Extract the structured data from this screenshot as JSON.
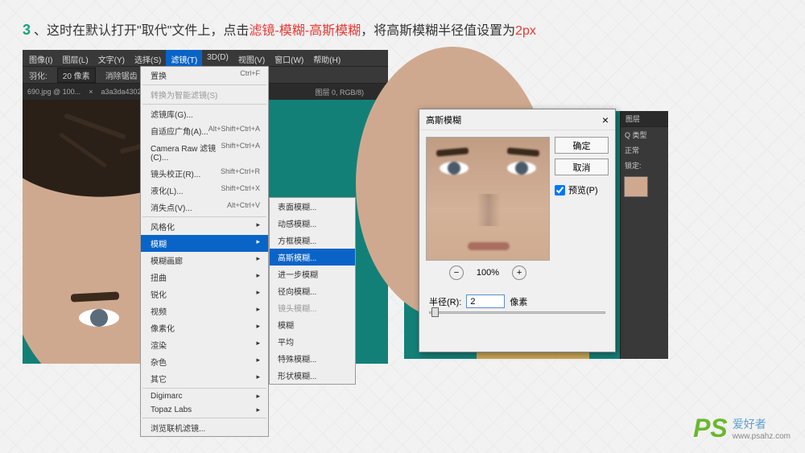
{
  "instruction": {
    "step": "3",
    "sep": "、",
    "t1": "这时在默认打开\"取代\"文件上，点击",
    "red": "滤镜-模糊-高斯模糊",
    "t2": "，将高斯模糊半径值设置为",
    "px": "2px"
  },
  "menubar": [
    "图像(I)",
    "图层(L)",
    "文字(Y)",
    "选择(S)",
    "滤镜(T)",
    "3D(D)",
    "视图(V)",
    "窗口(W)",
    "帮助(H)"
  ],
  "options": {
    "feather_label": "羽化:",
    "feather_val": "20 像素",
    "antialias": "消除锯齿"
  },
  "tabs": {
    "t1": "690.jpg @ 100...",
    "t2": "a3a3da43026a1...",
    "t3": "图层 0, RGB/8)"
  },
  "menu1": [
    {
      "label": "置换",
      "kb": "Ctrl+F"
    },
    {
      "label": "转换为智能滤镜(S)",
      "disabled": true
    },
    {
      "sep": true
    },
    {
      "label": "滤镜库(G)...",
      "arrow": false
    },
    {
      "label": "自适应广角(A)...",
      "kb": "Alt+Shift+Ctrl+A"
    },
    {
      "label": "Camera Raw 滤镜(C)...",
      "kb": "Shift+Ctrl+A"
    },
    {
      "label": "镜头校正(R)...",
      "kb": "Shift+Ctrl+R"
    },
    {
      "label": "液化(L)...",
      "kb": "Shift+Ctrl+X"
    },
    {
      "label": "消失点(V)...",
      "kb": "Alt+Ctrl+V"
    },
    {
      "sep": true
    },
    {
      "label": "风格化",
      "arrow": true
    },
    {
      "label": "模糊",
      "arrow": true,
      "hl": true
    },
    {
      "label": "模糊画廊",
      "arrow": true
    },
    {
      "label": "扭曲",
      "arrow": true
    },
    {
      "label": "锐化",
      "arrow": true
    },
    {
      "label": "视频",
      "arrow": true
    },
    {
      "label": "像素化",
      "arrow": true
    },
    {
      "label": "渲染",
      "arrow": true
    },
    {
      "label": "杂色",
      "arrow": true
    },
    {
      "label": "其它",
      "arrow": true
    },
    {
      "sep": true
    },
    {
      "label": "Digimarc",
      "arrow": true
    },
    {
      "label": "Topaz Labs",
      "arrow": true
    },
    {
      "sep": true
    },
    {
      "label": "浏览联机滤镜..."
    }
  ],
  "menu2": [
    {
      "label": "表面模糊..."
    },
    {
      "label": "动感模糊..."
    },
    {
      "label": "方框模糊..."
    },
    {
      "label": "高斯模糊...",
      "hl": true
    },
    {
      "label": "进一步模糊"
    },
    {
      "label": "径向模糊..."
    },
    {
      "label": "镜头模糊...",
      "disabled": true
    },
    {
      "label": "模糊"
    },
    {
      "label": "平均"
    },
    {
      "label": "特殊模糊..."
    },
    {
      "label": "形状模糊..."
    }
  ],
  "dialog": {
    "title": "高斯模糊",
    "ok": "确定",
    "cancel": "取消",
    "preview": "预览(P)",
    "zoom": "100%",
    "radius_label": "半径(R):",
    "radius_val": "2",
    "unit": "像素"
  },
  "layers": {
    "tab": "图层",
    "kind": "Q 类型",
    "mode": "正常",
    "lock": "锁定:"
  },
  "watermark": {
    "ps": "PS",
    "cn": "爱好者",
    "url": "www.psahz.com"
  }
}
